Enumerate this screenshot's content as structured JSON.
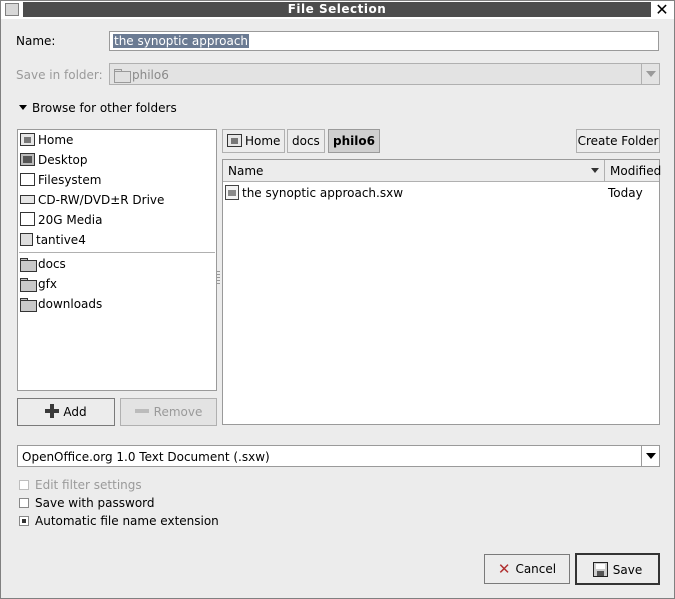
{
  "window": {
    "title": "File Selection",
    "close_glyph": "✕"
  },
  "name_row": {
    "label": "Name:",
    "value": "the synoptic approach"
  },
  "save_in": {
    "label": "Save in folder:",
    "value": "philo6"
  },
  "browse": {
    "label": "Browse for other folders",
    "expanded": true
  },
  "places": [
    {
      "label": "Home",
      "icon": "home-icon"
    },
    {
      "label": "Desktop",
      "icon": "desktop-icon"
    },
    {
      "label": "Filesystem",
      "icon": "filesystem-icon"
    },
    {
      "label": "CD-RW/DVD±R Drive",
      "icon": "drive-icon"
    },
    {
      "label": "20G Media",
      "icon": "media-icon"
    },
    {
      "label": "tantive4",
      "icon": "network-icon"
    }
  ],
  "bookmarks": [
    {
      "label": "docs",
      "icon": "folder-icon"
    },
    {
      "label": "gfx",
      "icon": "folder-icon"
    },
    {
      "label": "downloads",
      "icon": "folder-icon"
    }
  ],
  "buttons": {
    "add": "Add",
    "remove": "Remove",
    "create_folder": "Create Folder",
    "cancel": "Cancel",
    "save": "Save"
  },
  "path": [
    {
      "label": "Home"
    },
    {
      "label": "docs"
    },
    {
      "label": "philo6"
    }
  ],
  "file_list": {
    "columns": [
      "Name",
      "Modified"
    ],
    "rows": [
      {
        "name": "the synoptic approach.sxw",
        "modified": "Today"
      }
    ]
  },
  "filter": {
    "value": "OpenOffice.org 1.0 Text Document (.sxw)"
  },
  "options": [
    {
      "label": "Edit filter settings",
      "checked": false,
      "enabled": false
    },
    {
      "label": "Save with password",
      "checked": false,
      "enabled": true
    },
    {
      "label": "Automatic file name extension",
      "checked": true,
      "enabled": true
    }
  ]
}
